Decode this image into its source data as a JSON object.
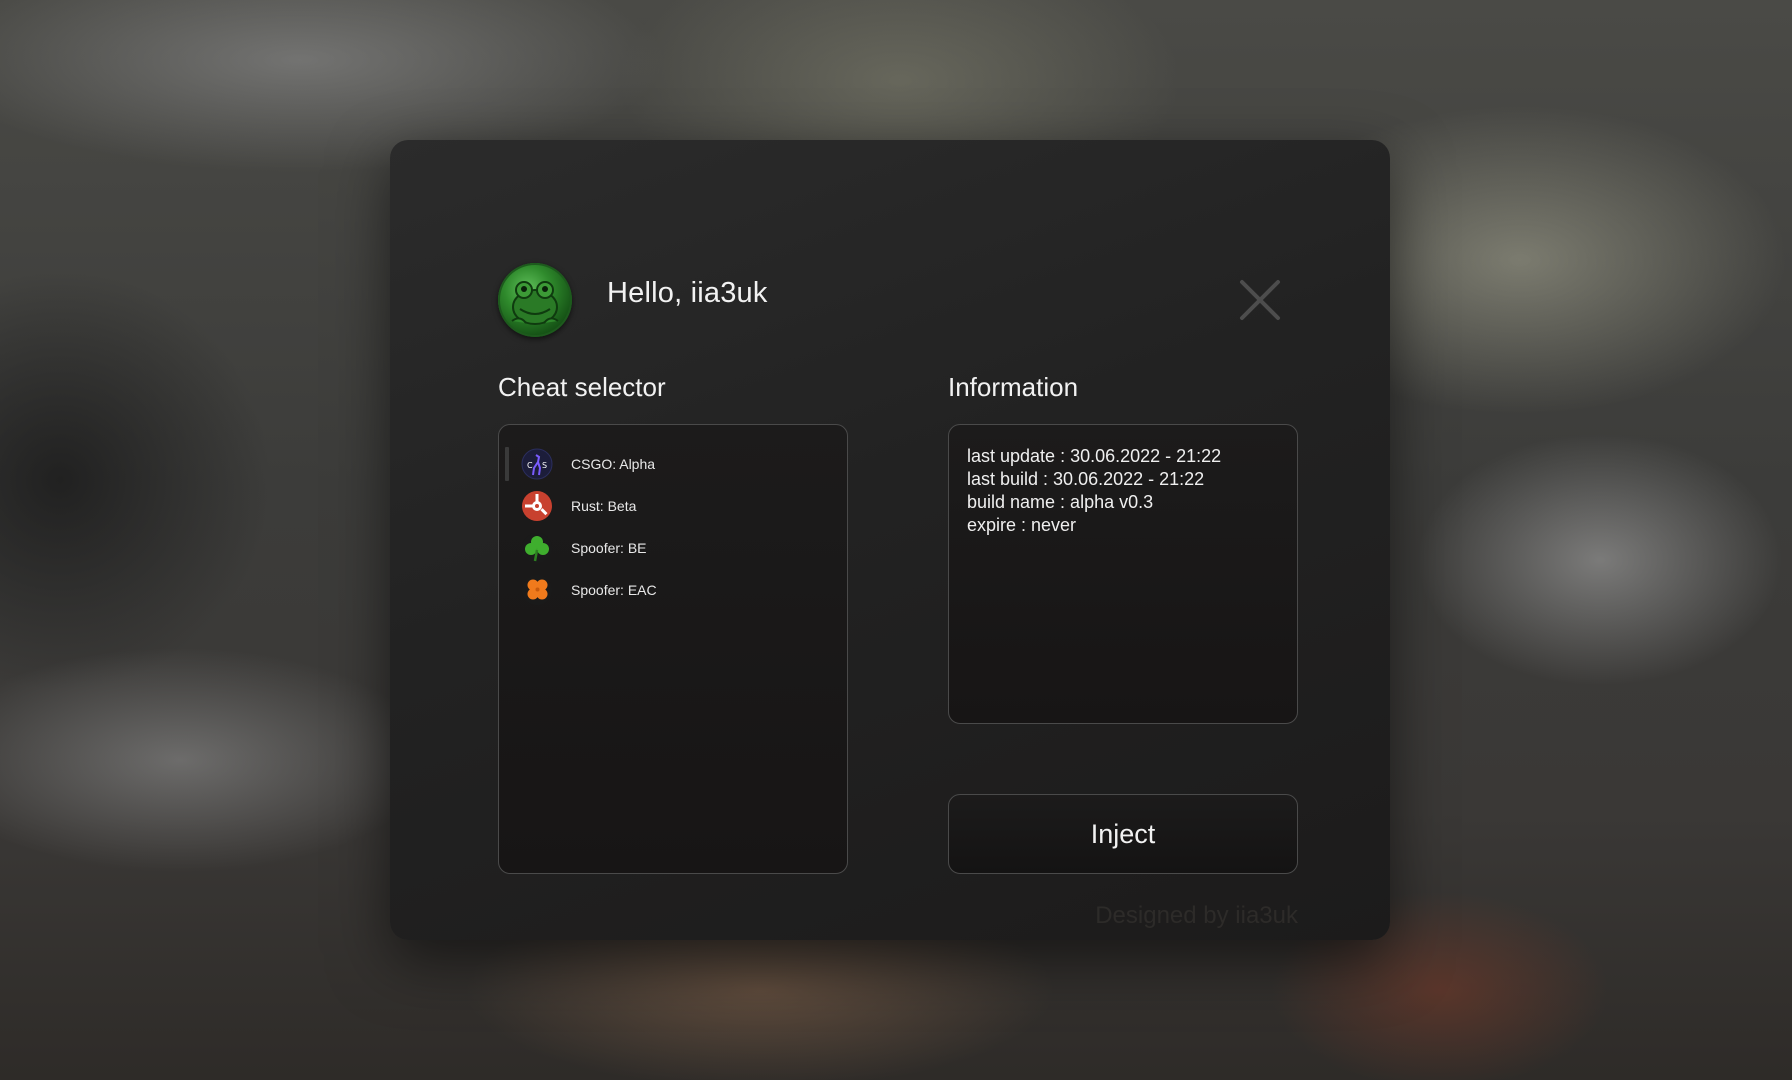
{
  "header": {
    "greeting": "Hello, iia3uk",
    "avatar_icon": "frog-avatar-icon",
    "close_icon": "close-icon"
  },
  "selector": {
    "title": "Cheat selector",
    "selected_index": 0,
    "items": [
      {
        "label": "CSGO: Alpha",
        "icon": "csgo-icon"
      },
      {
        "label": "Rust: Beta",
        "icon": "rust-icon"
      },
      {
        "label": "Spoofer: BE",
        "icon": "green-clover-icon"
      },
      {
        "label": "Spoofer: EAC",
        "icon": "orange-clover-icon"
      }
    ]
  },
  "info": {
    "title": "Information",
    "lines": [
      "last update : 30.06.2022 - 21:22",
      "last build : 30.06.2022 - 21:22",
      "build name : alpha v0.3",
      "expire : never"
    ]
  },
  "actions": {
    "inject_label": "Inject"
  },
  "footer": {
    "credit": "Designed by iia3uk"
  },
  "colors": {
    "window_bg": "#232323",
    "text": "#f2f2f2",
    "panel_border": "#4a4a4a",
    "clover_green": "#3fae2e",
    "clover_orange": "#f07a1c",
    "rust_red": "#c8412f"
  }
}
